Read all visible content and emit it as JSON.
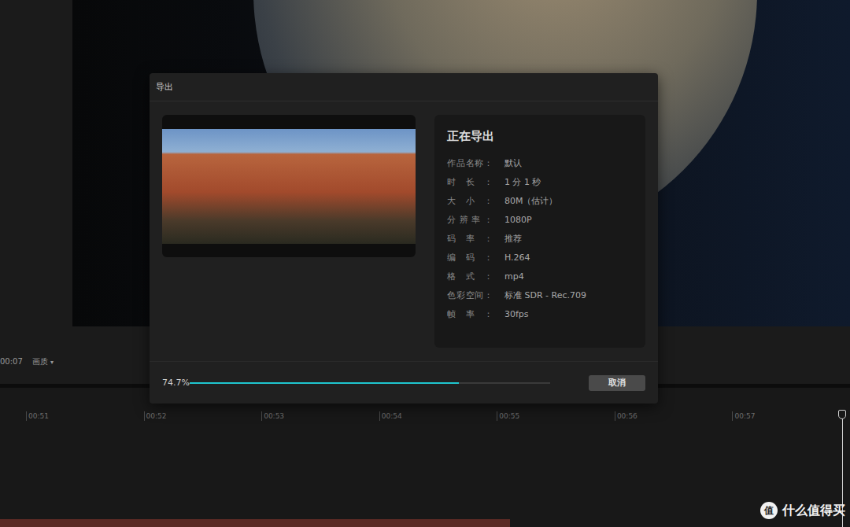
{
  "player": {
    "timecode": "00:07",
    "quality_menu": "画质",
    "quality_arrow": "▾"
  },
  "dialog": {
    "title": "导出",
    "status": "正在导出",
    "info": [
      {
        "label": "作品名称：",
        "value": "默认"
      },
      {
        "label": "时长：",
        "value": "1 分 1 秒"
      },
      {
        "label": "大小：",
        "value": "80M（估计）"
      },
      {
        "label": "分辨率：",
        "value": "1080P"
      },
      {
        "label": "码率：",
        "value": "推荐"
      },
      {
        "label": "编码：",
        "value": "H.264"
      },
      {
        "label": "格式：",
        "value": "mp4"
      },
      {
        "label": "色彩空间：",
        "value": "标准 SDR - Rec.709"
      },
      {
        "label": "帧率：",
        "value": "30fps"
      }
    ],
    "progress": {
      "level": 0.747,
      "text": "74.7%"
    },
    "buttons": [
      "取消"
    ]
  },
  "timeline": {
    "ticks": [
      "00:51",
      "00:52",
      "00:53",
      "00:54",
      "00:55",
      "00:56",
      "00:57"
    ]
  },
  "watermark": {
    "icon_text": "值",
    "text": "什么值得买"
  }
}
